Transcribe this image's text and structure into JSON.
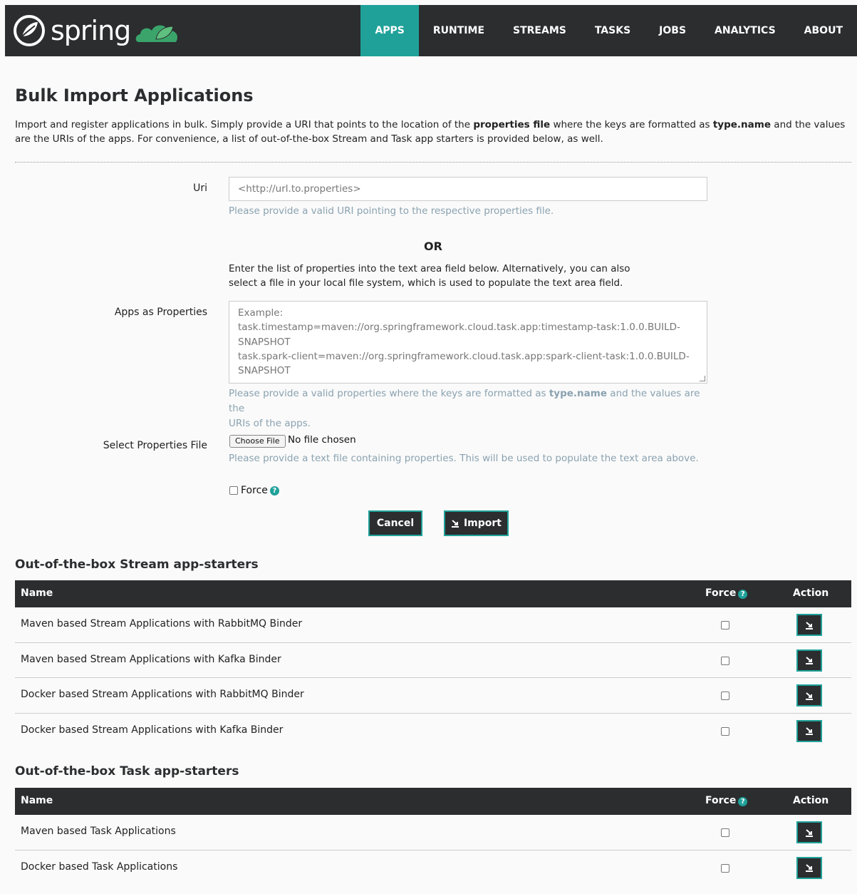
{
  "brand": {
    "name": "spring"
  },
  "nav": {
    "items": [
      {
        "label": "APPS",
        "active": true
      },
      {
        "label": "RUNTIME"
      },
      {
        "label": "STREAMS"
      },
      {
        "label": "TASKS"
      },
      {
        "label": "JOBS"
      },
      {
        "label": "ANALYTICS"
      },
      {
        "label": "ABOUT"
      }
    ]
  },
  "page": {
    "title": "Bulk Import Applications",
    "intro_1": "Import and register applications in bulk. Simply provide a URI that points to the location of the ",
    "intro_bold_1": "properties file",
    "intro_2": " where the keys are formatted as ",
    "intro_bold_2": "type.name",
    "intro_3": " and the values are the URIs of the apps. For convenience, a list of out-of-the-box Stream and Task app starters is provided below, as well."
  },
  "form": {
    "uri_label": "Uri",
    "uri_placeholder": "<http://url.to.properties>",
    "uri_help": "Please provide a valid URI pointing to the respective properties file.",
    "or_text": "OR",
    "or_desc_1": "Enter the list of properties into the text area field below. Alternatively, you can also",
    "or_desc_2": "select a file in your local file system, which is used to populate the text area field.",
    "apps_label": "Apps as Properties",
    "apps_placeholder": [
      "Example:",
      "task.timestamp=maven://org.springframework.cloud.task.app:timestamp-task:1.0.0.BUILD-",
      "SNAPSHOT",
      "task.spark-client=maven://org.springframework.cloud.task.app:spark-client-task:1.0.0.BUILD-",
      "SNAPSHOT"
    ],
    "apps_help_1": "Please provide a valid properties where the keys are formatted as ",
    "apps_help_bold": "type.name",
    "apps_help_2": " and the values are the",
    "apps_help_3": "URIs of the apps.",
    "file_label": "Select Properties File",
    "file_button": "Choose File",
    "file_status": "No file chosen",
    "file_help": "Please provide a text file containing properties. This will be used to populate the text area above.",
    "force_label": "Force",
    "cancel_label": "Cancel",
    "import_label": "Import"
  },
  "stream_section": {
    "title": "Out-of-the-box Stream app-starters",
    "headers": {
      "name": "Name",
      "force": "Force",
      "action": "Action"
    },
    "rows": [
      {
        "name": "Maven based Stream Applications with RabbitMQ Binder"
      },
      {
        "name": "Maven based Stream Applications with Kafka Binder"
      },
      {
        "name": "Docker based Stream Applications with RabbitMQ Binder"
      },
      {
        "name": "Docker based Stream Applications with Kafka Binder"
      }
    ]
  },
  "task_section": {
    "title": "Out-of-the-box Task app-starters",
    "headers": {
      "name": "Name",
      "force": "Force",
      "action": "Action"
    },
    "rows": [
      {
        "name": "Maven based Task Applications"
      },
      {
        "name": "Docker based Task Applications"
      }
    ]
  },
  "colors": {
    "nav_bg": "#2b2d2f",
    "accent": "#1fa199",
    "help_text": "#8aa2b0"
  }
}
